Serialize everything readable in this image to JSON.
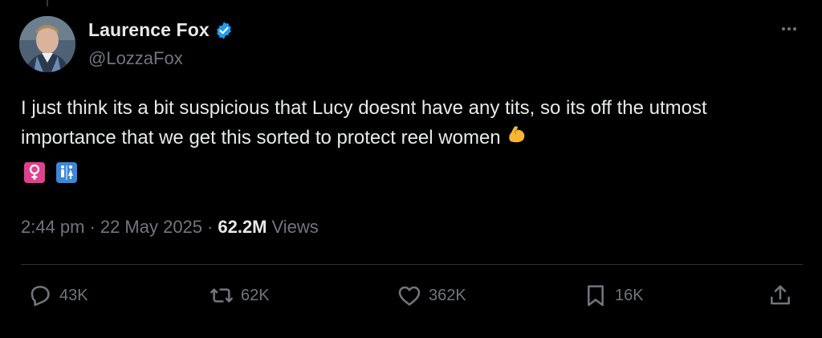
{
  "author": {
    "display_name": "Laurence Fox",
    "handle": "@LozzaFox",
    "verified_icon": "verified-badge-icon"
  },
  "tweet": {
    "text": "I just think its a bit suspicious that Lucy doesnt have any tits, so its off the utmost importance that we get this sorted to protect reel women",
    "emojis": [
      "flexed-biceps",
      "female-sign",
      "restroom-sign"
    ]
  },
  "meta": {
    "time": "2:44 pm",
    "separator": "·",
    "date": "22 May 2025",
    "views_count": "62.2M",
    "views_label": "Views"
  },
  "actions": {
    "replies": "43K",
    "reposts": "62K",
    "likes": "362K",
    "bookmarks": "16K"
  },
  "colors": {
    "background": "#000000",
    "text": "#e7e9ea",
    "muted": "#71767b",
    "verified": "#1d9bf0",
    "divider": "#2f3336"
  }
}
